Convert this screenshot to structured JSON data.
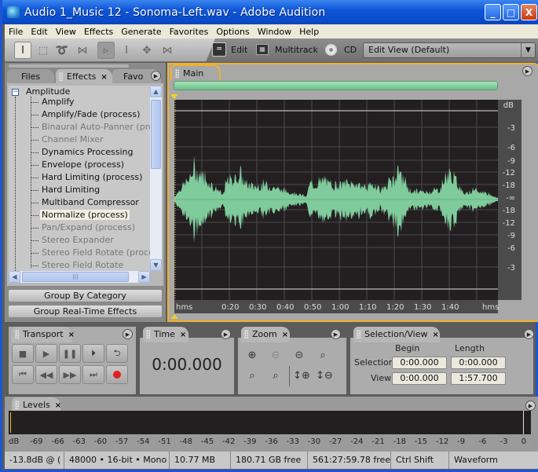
{
  "window": {
    "title": "Audio 1_Music 12 - Sonoma-Left.wav - Adobe Audition",
    "minimize": "_",
    "maximize": "□",
    "close": "X"
  },
  "menu": [
    "File",
    "Edit",
    "View",
    "Effects",
    "Generate",
    "Favorites",
    "Options",
    "Window",
    "Help"
  ],
  "toolbar": {
    "tools": [
      {
        "name": "time-selection-tool",
        "glyph": "I"
      },
      {
        "name": "marquee-tool",
        "glyph": "⬚"
      },
      {
        "name": "lasso-tool",
        "glyph": "➰"
      },
      {
        "name": "scrub-tool",
        "glyph": "⋈"
      },
      {
        "name": "move-copy-clip-tool",
        "glyph": "▹"
      },
      {
        "name": "hybrid-tool",
        "glyph": "I"
      },
      {
        "name": "move-tool",
        "glyph": "✥"
      },
      {
        "name": "scrub-tool-2",
        "glyph": "⋈"
      }
    ],
    "edit_label": "Edit",
    "multitrack_label": "Multitrack",
    "cd_label": "CD",
    "workspace": "Edit View (Default)"
  },
  "left_panel": {
    "tabs": [
      "Files",
      "Effects",
      "Favo"
    ],
    "active_tab": "Effects",
    "category": "Amplitude",
    "items": [
      {
        "label": "Amplify",
        "enabled": true
      },
      {
        "label": "Amplify/Fade (process)",
        "enabled": true
      },
      {
        "label": "Binaural Auto-Panner (proce",
        "enabled": false
      },
      {
        "label": "Channel Mixer",
        "enabled": false
      },
      {
        "label": "Dynamics Processing",
        "enabled": true
      },
      {
        "label": "Envelope (process)",
        "enabled": true
      },
      {
        "label": "Hard Limiting (process)",
        "enabled": true
      },
      {
        "label": "Hard Limiting",
        "enabled": true
      },
      {
        "label": "Multiband Compressor",
        "enabled": true
      },
      {
        "label": "Normalize (process)",
        "enabled": true,
        "selected": true
      },
      {
        "label": "Pan/Expand (process)",
        "enabled": false
      },
      {
        "label": "Stereo Expander",
        "enabled": false
      },
      {
        "label": "Stereo Field Rotate (process",
        "enabled": false
      },
      {
        "label": "Stereo Field Rotate",
        "enabled": false
      }
    ],
    "group_by_category": "Group By Category",
    "group_realtime": "Group Real-Time Effects"
  },
  "main_panel": {
    "tab": "Main",
    "db_scale_label": "dB",
    "db_ticks": [
      "-3",
      "-6",
      "-9",
      "-12",
      "-18",
      "-∞",
      "-18",
      "-12",
      "-9",
      "-6",
      "-3"
    ],
    "time_unit_left": "hms",
    "time_unit_right": "hms",
    "time_ticks": [
      "0:20",
      "0:30",
      "0:40",
      "0:50",
      "1:00",
      "1:10",
      "1:20",
      "1:30",
      "1:40"
    ],
    "waveform_color": "#7fcb9c"
  },
  "transport": {
    "tab": "Transport",
    "buttons": [
      "stop",
      "play",
      "pause",
      "play-from-cursor",
      "loop",
      "go-to-start",
      "rewind",
      "fast-forward",
      "go-to-end",
      "record"
    ]
  },
  "time": {
    "tab": "Time",
    "value": "0:00.000"
  },
  "zoom": {
    "tab": "Zoom",
    "buttons": [
      "zoom-in-horizontal",
      "zoom-out-horizontal",
      "zoom-out-full",
      "zoom-to-selection",
      "zoom-to-left-edge",
      "zoom-to-right-edge",
      "zoom-in-vertical",
      "zoom-out-vertical"
    ]
  },
  "selection_view": {
    "tab": "Selection/View",
    "col_begin": "Begin",
    "col_length": "Length",
    "row_selection": "Selection",
    "row_view": "View",
    "selection_begin": "0:00.000",
    "selection_length": "0:00.000",
    "view_begin": "0:00.000",
    "view_length": "1:57.700"
  },
  "levels": {
    "tab": "Levels",
    "ticks": [
      "dB",
      "-69",
      "-66",
      "-63",
      "-60",
      "-57",
      "-54",
      "-51",
      "-48",
      "-45",
      "-42",
      "-39",
      "-36",
      "-33",
      "-30",
      "-27",
      "-24",
      "-21",
      "-18",
      "-15",
      "-12",
      "-9",
      "-6",
      "-3",
      "0"
    ]
  },
  "status": {
    "level": "-13.8dB @  (",
    "format": "48000 • 16-bit • Mono",
    "size": "10.77 MB",
    "disk_free": "180.71 GB free",
    "time_free": "561:27:59.78 free",
    "keys": "Ctrl Shift",
    "view": "Waveform"
  }
}
